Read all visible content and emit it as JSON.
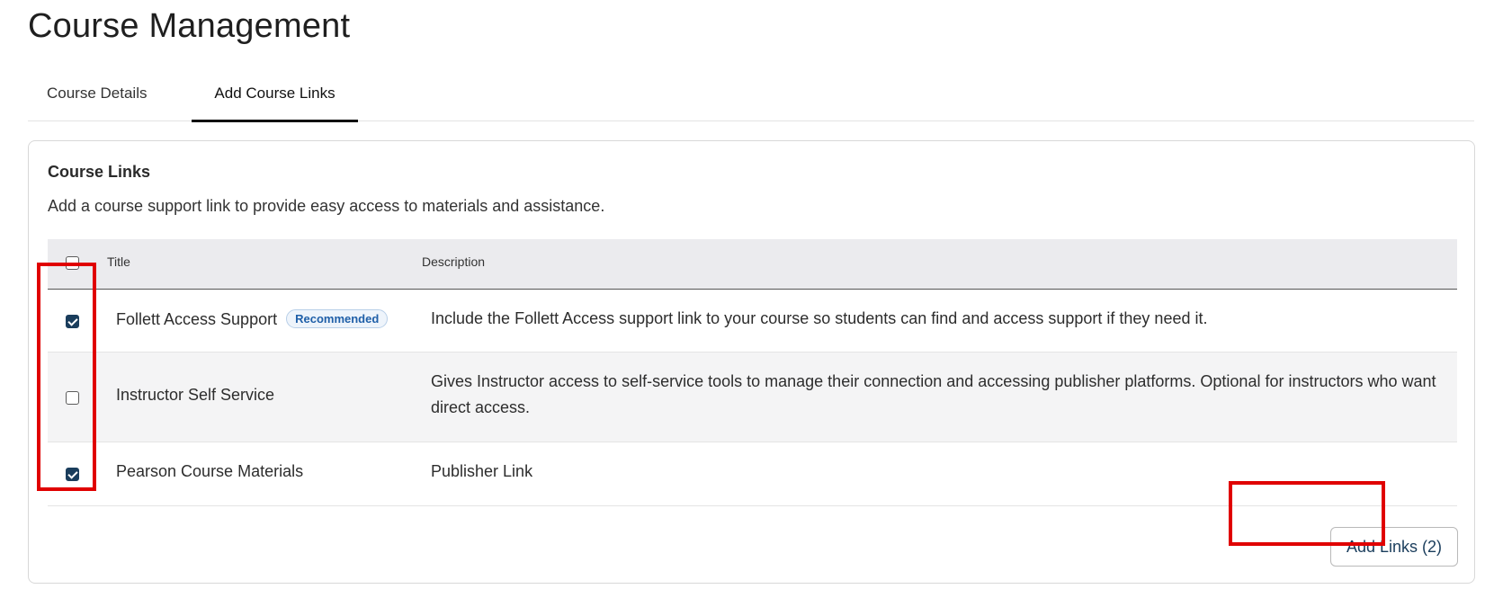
{
  "page": {
    "title": "Course Management"
  },
  "tabs": [
    {
      "label": "Course Details",
      "active": false
    },
    {
      "label": "Add Course Links",
      "active": true
    }
  ],
  "card": {
    "title": "Course Links",
    "description": "Add a course support link to provide easy access to materials and assistance."
  },
  "table": {
    "headers": {
      "title": "Title",
      "description": "Description"
    },
    "select_all_checked": false,
    "rows": [
      {
        "title": "Follett Access Support",
        "badge": "Recommended",
        "description": "Include the Follett Access support link to your course so students can find and access support if they need it.",
        "checked": true
      },
      {
        "title": "Instructor Self Service",
        "badge": "",
        "description": "Gives Instructor access to self-service tools to manage their connection and accessing publisher platforms. Optional for instructors who want direct access.",
        "checked": false
      },
      {
        "title": "Pearson Course Materials",
        "badge": "",
        "description": "Publisher Link",
        "checked": true
      }
    ]
  },
  "actions": {
    "add_links_label": "Add Links (2)"
  },
  "colors": {
    "accent": "#1a3d5c",
    "highlight": "#e00000",
    "badge_text": "#1f5fa8"
  }
}
